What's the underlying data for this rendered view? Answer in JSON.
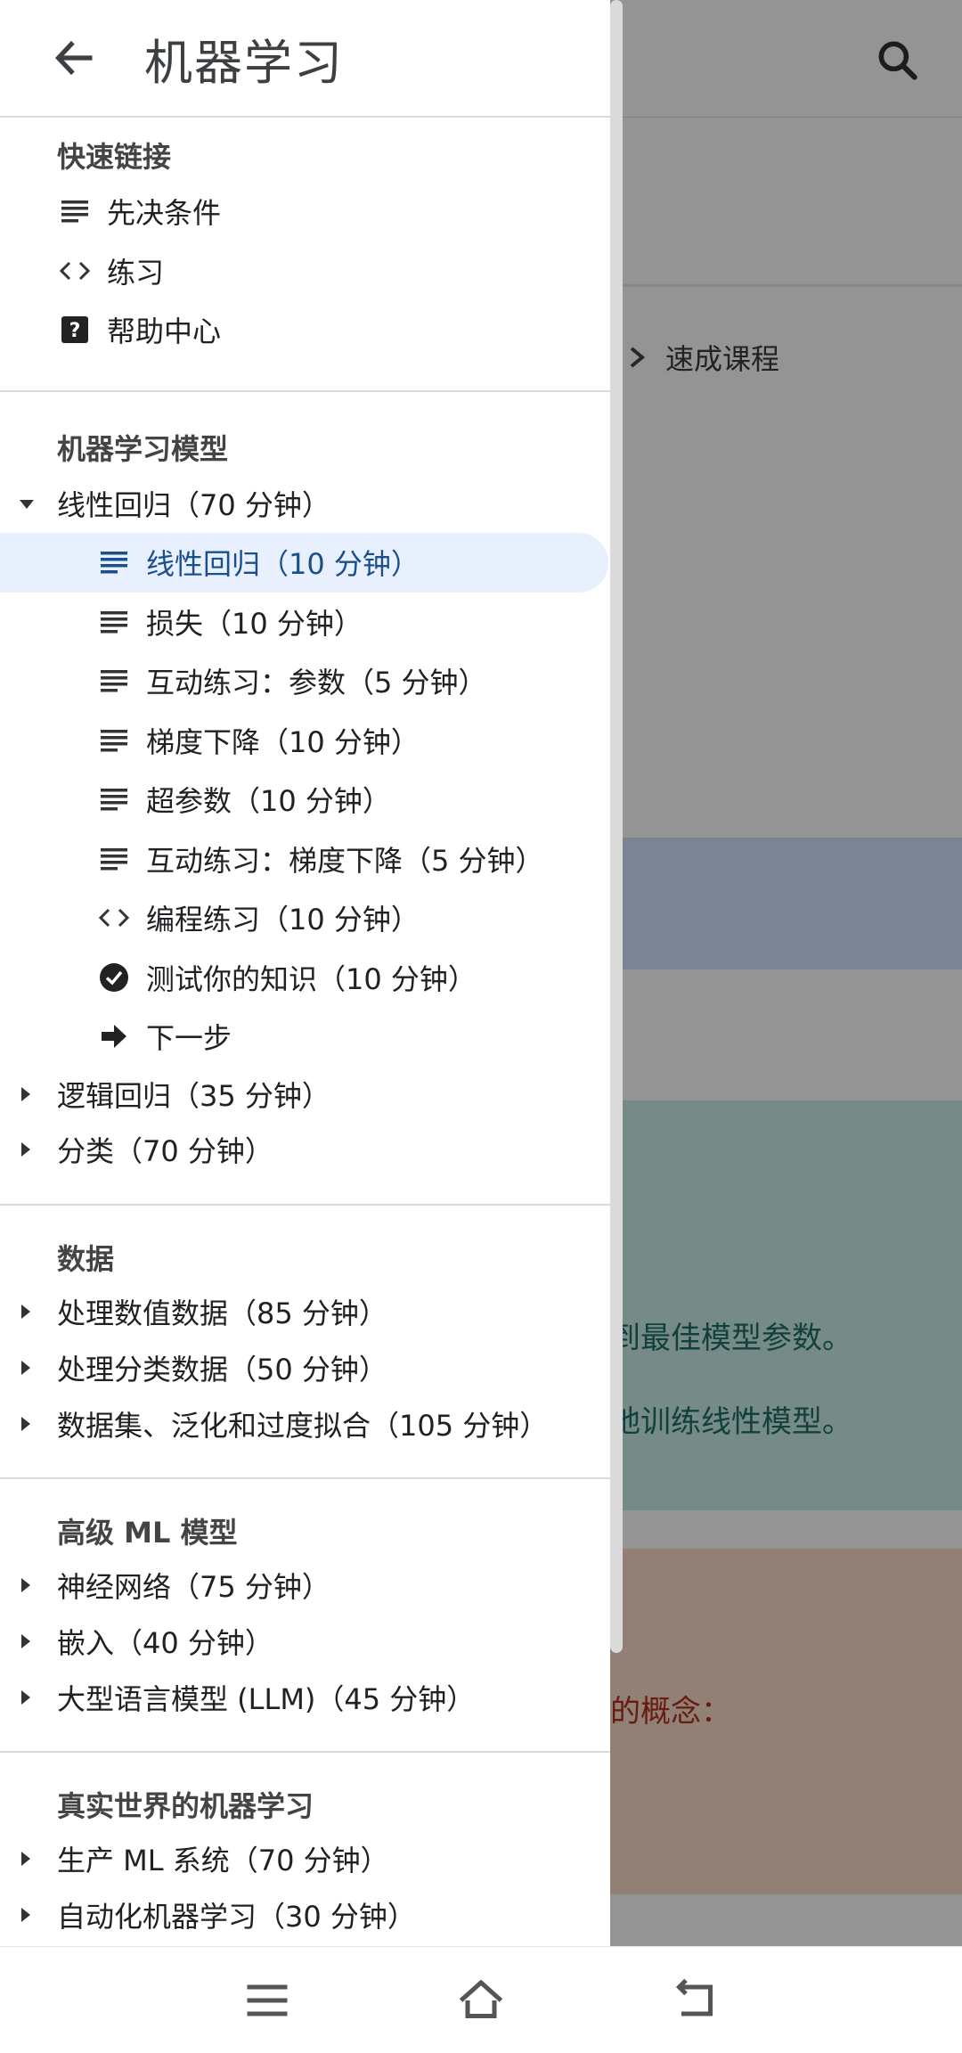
{
  "drawer": {
    "title": "机器学习",
    "back_icon": "arrow-left-icon",
    "quick_links": {
      "title": "快速链接",
      "items": [
        {
          "label": "先决条件",
          "icon": "lines-icon"
        },
        {
          "label": "练习",
          "icon": "code-icon"
        },
        {
          "label": "帮助中心",
          "icon": "help-box-icon"
        }
      ]
    },
    "ml_models": {
      "title": "机器学习模型",
      "parents": [
        {
          "label": "线性回归（70 分钟）",
          "expanded": true
        },
        {
          "label": "逻辑回归（35 分钟）",
          "expanded": false
        },
        {
          "label": "分类（70 分钟）",
          "expanded": false
        }
      ],
      "children": [
        {
          "label": "线性回归（10 分钟）",
          "icon": "lines-icon",
          "active": true
        },
        {
          "label": "损失（10 分钟）",
          "icon": "lines-icon"
        },
        {
          "label": "互动练习：参数（5 分钟）",
          "icon": "lines-icon"
        },
        {
          "label": "梯度下降（10 分钟）",
          "icon": "lines-icon"
        },
        {
          "label": "超参数（10 分钟）",
          "icon": "lines-icon"
        },
        {
          "label": "互动练习：梯度下降（5 分钟）",
          "icon": "lines-icon"
        },
        {
          "label": "编程练习（10 分钟）",
          "icon": "code-icon"
        },
        {
          "label": "测试你的知识（10 分钟）",
          "icon": "check-circle-icon"
        },
        {
          "label": "下一步",
          "icon": "arrow-right-icon"
        }
      ]
    },
    "data_section": {
      "title": "数据",
      "items": [
        {
          "label": "处理数值数据（85 分钟）"
        },
        {
          "label": "处理分类数据（50 分钟）"
        },
        {
          "label": "数据集、泛化和过度拟合（105 分钟）"
        }
      ]
    },
    "advanced": {
      "title": "高级 ML 模型",
      "items": [
        {
          "label": "神经网络（75 分钟）"
        },
        {
          "label": "嵌入（40 分钟）"
        },
        {
          "label": "大型语言模型 (LLM)（45 分钟）"
        }
      ]
    },
    "real_world": {
      "title": "真实世界的机器学习",
      "items": [
        {
          "label": "生产 ML 系统（70 分钟）"
        },
        {
          "label": "自动化机器学习（30 分钟）"
        }
      ]
    }
  },
  "background": {
    "breadcrumb": "速成课程",
    "teal_text_1": "到最佳模型参数。",
    "teal_text_2": "地训练线性模型。",
    "orange_text": "的概念："
  },
  "colors": {
    "active_bg": "#e8f0fe",
    "active_text": "#1a4f8b",
    "overlay": "rgba(0,0,0,0.42)"
  },
  "navbar": {
    "icons": [
      "menu-icon",
      "home-icon",
      "back-icon"
    ]
  }
}
